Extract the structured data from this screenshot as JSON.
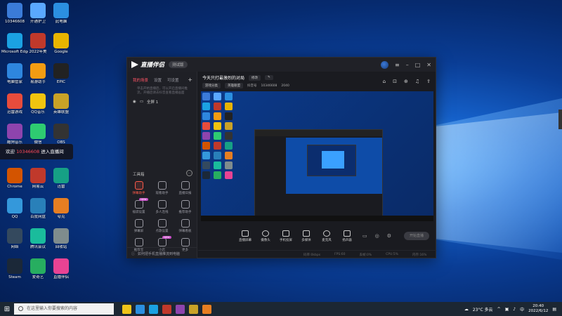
{
  "desktop": {
    "icons": [
      {
        "label": "10346608",
        "color": "#3b7bd8"
      },
      {
        "label": "开通护卫",
        "color": "#5aa8ff"
      },
      {
        "label": "此电脑",
        "color": "#2b8fe0"
      },
      {
        "label": "Microsoft Edge",
        "color": "#1ba1e2"
      },
      {
        "label": "2022年美",
        "color": "#c0392b"
      },
      {
        "label": "Google",
        "color": "#e8b400"
      },
      {
        "label": "电脑管家",
        "color": "#2e86de"
      },
      {
        "label": "易游助手",
        "color": "#f39c12"
      },
      {
        "label": "EPIC",
        "color": "#222222"
      },
      {
        "label": "迅雷游戏",
        "color": "#e74c3c"
      },
      {
        "label": "QQ音乐",
        "color": "#f1c40f"
      },
      {
        "label": "英雄联盟",
        "color": "#c9a227"
      },
      {
        "label": "酷狗音乐",
        "color": "#8e44ad"
      },
      {
        "label": "微信",
        "color": "#2ecc71"
      },
      {
        "label": "OBS",
        "color": "#333333"
      },
      {
        "label": "Chrome",
        "color": "#d35400"
      },
      {
        "label": "网易云",
        "color": "#c0392b"
      },
      {
        "label": "迅雷",
        "color": "#16a085"
      },
      {
        "label": "QQ",
        "color": "#3498db"
      },
      {
        "label": "百度网盘",
        "color": "#2980b9"
      },
      {
        "label": "夸克",
        "color": "#e67e22"
      },
      {
        "label": "网络",
        "color": "#34495e"
      },
      {
        "label": "腾讯会议",
        "color": "#1abc9c"
      },
      {
        "label": "回收站",
        "color": "#7f8c8d"
      },
      {
        "label": "Steam",
        "color": "#1b2838"
      },
      {
        "label": "爱奇艺",
        "color": "#27ae60"
      },
      {
        "label": "直播伴侣",
        "color": "#e84393"
      }
    ],
    "toast": {
      "prefix": "欢迎 ",
      "highlight": "10346608",
      "suffix": " 进入直播间"
    }
  },
  "app": {
    "title": "直播伴侣",
    "version": "测试版",
    "left_tabs": [
      "我的场景",
      "设置",
      "可设置"
    ],
    "note": "单击开始直播后，可以开启直播间推流，开播后请去抖音查看直播画面",
    "scene_label": "全屏 1",
    "tools_heading": "工具箱",
    "tools": [
      {
        "label": "弹幕助手",
        "active": true,
        "badge": ""
      },
      {
        "label": "观看助手",
        "active": false,
        "badge": ""
      },
      {
        "label": "直播日报",
        "active": false,
        "badge": ""
      },
      {
        "label": "福袋设置",
        "active": false,
        "badge": "NEW"
      },
      {
        "label": "多人连线",
        "active": false,
        "badge": ""
      },
      {
        "label": "推荐助手",
        "active": false,
        "badge": ""
      },
      {
        "label": "弹幕屏",
        "active": false,
        "badge": ""
      },
      {
        "label": "点歌设置",
        "active": false,
        "badge": ""
      },
      {
        "label": "弹幕看板",
        "active": false,
        "badge": ""
      },
      {
        "label": "推荐宝",
        "active": false,
        "badge": ""
      },
      {
        "label": "小店",
        "active": false,
        "badge": "NEW"
      },
      {
        "label": "更多",
        "active": false,
        "badge": ""
      }
    ],
    "left_footer": "如何把手机直播推流到电脑",
    "room_title": "今天只打最激烈的对局",
    "room_edit": "修改",
    "room_tag": "游戏分类",
    "room_category": "英雄联盟",
    "room_id_label": "抖音号",
    "room_id": "10346608",
    "room_extra": "2040",
    "bottom_buttons": [
      "直播屏幕",
      "摄像头",
      "手机投屏",
      "多媒体",
      "麦克风",
      "扬声器"
    ],
    "start_label": "开始直播",
    "status": [
      "码率:0kbps",
      "FPS:60",
      "丢帧:0%",
      "CPU:5%",
      "内存:16%"
    ]
  },
  "taskbar": {
    "search_placeholder": "在这里输入你要搜索的内容",
    "weather": "23°C 多云",
    "time": "20:40",
    "date": "2022/6/12",
    "app_colors": [
      "#f0c419",
      "#2b8fe0",
      "#1ba1e2",
      "#c0392b",
      "#8e44ad",
      "#c9a227",
      "#e67e22"
    ]
  }
}
